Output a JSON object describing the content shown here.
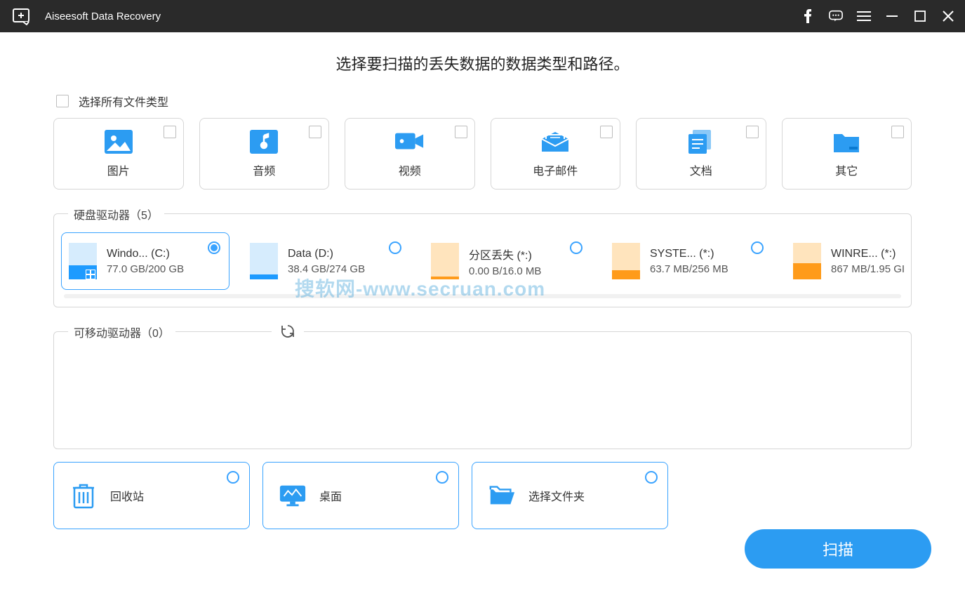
{
  "titlebar": {
    "app_name": "Aiseesoft Data Recovery"
  },
  "heading": "选择要扫描的丢失数据的数据类型和路径。",
  "select_all_label": "选择所有文件类型",
  "types": [
    {
      "label": "图片"
    },
    {
      "label": "音频"
    },
    {
      "label": "视频"
    },
    {
      "label": "电子邮件"
    },
    {
      "label": "文档"
    },
    {
      "label": "其它"
    }
  ],
  "hdd_section_label": "硬盘驱动器（5）",
  "drives": [
    {
      "name": "Windo... (C:)",
      "size": "77.0 GB/200 GB",
      "selected": true,
      "fill_pct": 38,
      "color": "blue",
      "winlogo": true
    },
    {
      "name": "Data (D:)",
      "size": "38.4 GB/274 GB",
      "selected": false,
      "fill_pct": 14,
      "color": "blue"
    },
    {
      "name": "分区丢失 (*:)",
      "size": "0.00  B/16.0 MB",
      "selected": false,
      "fill_pct": 4,
      "color": "orange"
    },
    {
      "name": "SYSTE... (*:)",
      "size": "63.7 MB/256 MB",
      "selected": false,
      "fill_pct": 25,
      "color": "orange"
    },
    {
      "name": "WINRE... (*:)",
      "size": "867 MB/1.95 GI",
      "selected": false,
      "fill_pct": 44,
      "color": "orange"
    }
  ],
  "removable_label": "可移动驱动器（0）",
  "locations": [
    {
      "label": "回收站"
    },
    {
      "label": "桌面"
    },
    {
      "label": "选择文件夹"
    }
  ],
  "scan_label": "扫描",
  "watermark": "搜软网-www.secruan.com"
}
